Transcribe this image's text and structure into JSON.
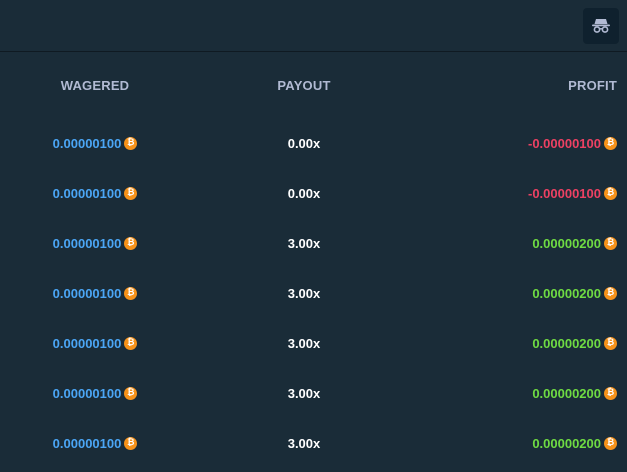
{
  "toolbar": {
    "incognito_icon": "incognito-icon"
  },
  "table": {
    "headers": {
      "wagered": "WAGERED",
      "payout": "PAYOUT",
      "profit": "PROFIT"
    },
    "coin_icon": "bitcoin-icon",
    "coin_symbol": "₿",
    "rows": [
      {
        "wagered": "0.00000100",
        "payout": "0.00x",
        "profit": "-0.00000100",
        "profit_sign": "negative"
      },
      {
        "wagered": "0.00000100",
        "payout": "0.00x",
        "profit": "-0.00000100",
        "profit_sign": "negative"
      },
      {
        "wagered": "0.00000100",
        "payout": "3.00x",
        "profit": "0.00000200",
        "profit_sign": "positive"
      },
      {
        "wagered": "0.00000100",
        "payout": "3.00x",
        "profit": "0.00000200",
        "profit_sign": "positive"
      },
      {
        "wagered": "0.00000100",
        "payout": "3.00x",
        "profit": "0.00000200",
        "profit_sign": "positive"
      },
      {
        "wagered": "0.00000100",
        "payout": "3.00x",
        "profit": "0.00000200",
        "profit_sign": "positive"
      },
      {
        "wagered": "0.00000100",
        "payout": "3.00x",
        "profit": "0.00000200",
        "profit_sign": "positive"
      }
    ]
  },
  "colors": {
    "background": "#1a2c38",
    "wagered": "#4ba6f5",
    "profit_negative": "#ed4163",
    "profit_positive": "#6fdb43",
    "coin": "#f7931a"
  }
}
